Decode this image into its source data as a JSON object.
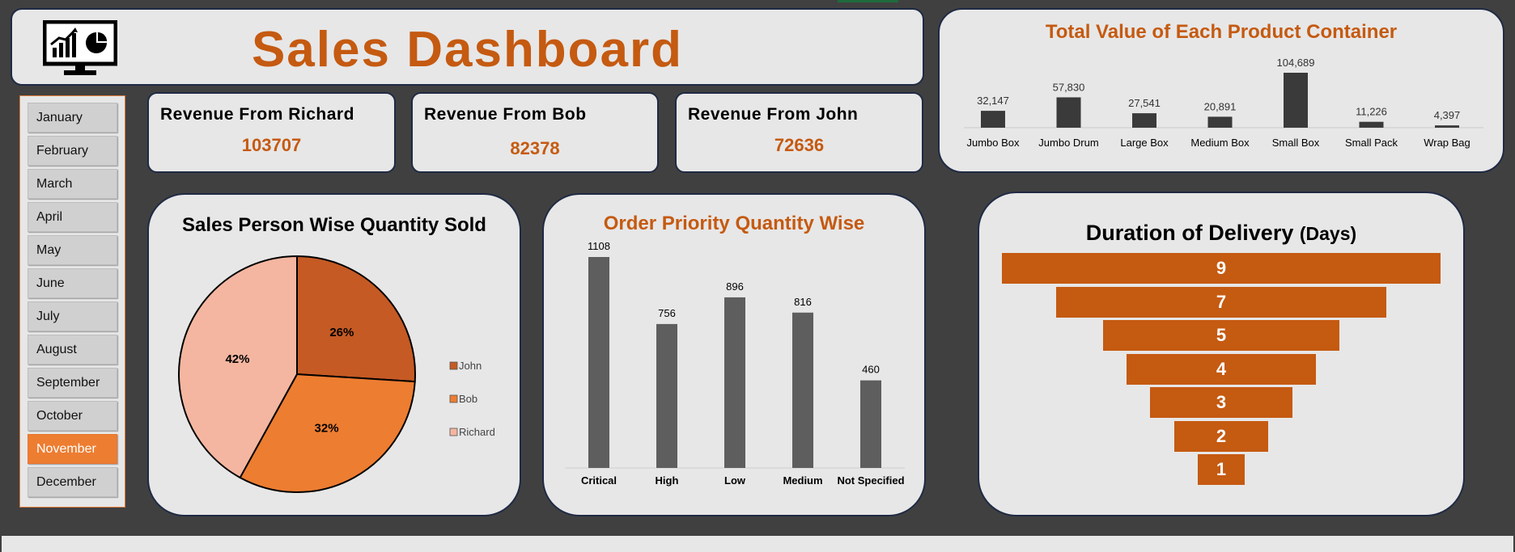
{
  "dashboard": {
    "title": "Sales Dashboard",
    "accent_color": "#c55a11",
    "logo_icon": "monitor-chart-icon"
  },
  "months": {
    "items": [
      "January",
      "February",
      "March",
      "April",
      "May",
      "June",
      "July",
      "August",
      "September",
      "October",
      "November",
      "December"
    ],
    "selected": "November",
    "selected_color": "#ed7d31"
  },
  "revenue": [
    {
      "label": "Revenue From Richard",
      "value": "103707"
    },
    {
      "label": "Revenue From Bob",
      "value": "82378"
    },
    {
      "label": "Revenue From John",
      "value": "72636"
    }
  ],
  "chart_data": [
    {
      "type": "bar",
      "title": "Total Value of Each Product Container",
      "categories": [
        "Jumbo Box",
        "Jumbo Drum",
        "Large Box",
        "Medium Box",
        "Small Box",
        "Small Pack",
        "Wrap Bag"
      ],
      "values": [
        32147,
        57830,
        27541,
        20891,
        104689,
        11226,
        4397
      ],
      "data_labels": [
        "32,147",
        "57,830",
        "27,541",
        "20,891",
        "104,689",
        "11,226",
        "4,397"
      ],
      "bar_color": "#3a3a3a",
      "title_color": "#c55a11"
    },
    {
      "type": "pie",
      "title": "Sales Person Wise Quantity Sold",
      "slices": [
        {
          "name": "John",
          "value": 26,
          "label": "26%",
          "color": "#c55a24"
        },
        {
          "name": "Bob",
          "value": 32,
          "label": "32%",
          "color": "#ed7d31"
        },
        {
          "name": "Richard",
          "value": 42,
          "label": "42%",
          "color": "#f4b6a0"
        }
      ],
      "legend": "right"
    },
    {
      "type": "bar",
      "title": "Order Priority Quantity Wise",
      "categories": [
        "Critical",
        "High",
        "Low",
        "Medium",
        "Not Specified"
      ],
      "values": [
        1108,
        756,
        896,
        816,
        460
      ],
      "data_labels": [
        "1108",
        "756",
        "896",
        "816",
        "460"
      ],
      "bar_color": "#5e5e5e",
      "title_color": "#c55a11"
    },
    {
      "type": "funnel",
      "title": "Duration of Delivery",
      "title_unit": "(Days)",
      "values": [
        9,
        7,
        5,
        4,
        3,
        2,
        1
      ],
      "labels": [
        "9",
        "7",
        "5",
        "4",
        "3",
        "2",
        "1"
      ],
      "bar_color": "#c55a11"
    }
  ]
}
